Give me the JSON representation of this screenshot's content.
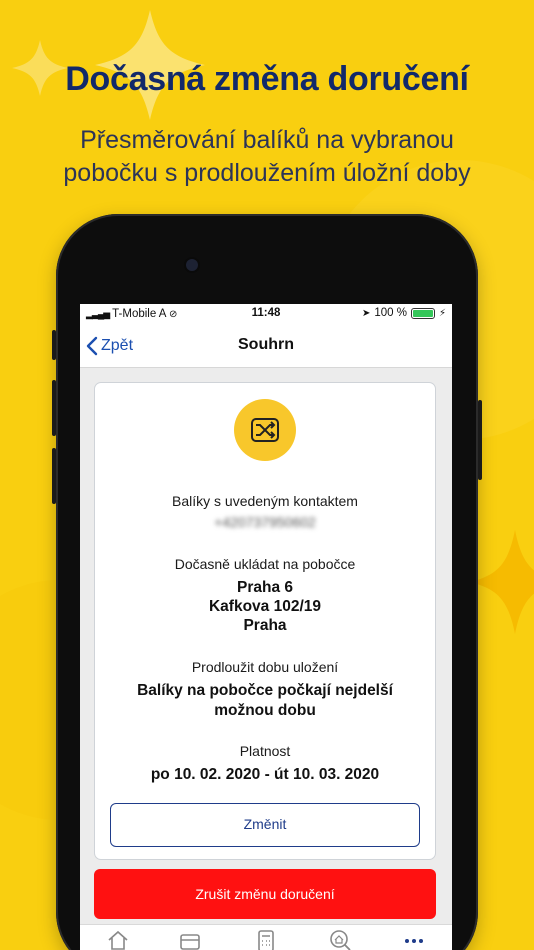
{
  "promo": {
    "title": "Dočasná změna doručení",
    "subtitle_line1": "Přesměrování balíků na vybranou",
    "subtitle_line2": "pobočku s prodloužením úložní doby"
  },
  "status_bar": {
    "carrier": "T-Mobile A",
    "time": "11:48",
    "battery": "100 %"
  },
  "nav": {
    "back_label": "Zpět",
    "title": "Souhrn"
  },
  "summary": {
    "icon": "shuffle-icon",
    "contact_label": "Balíky s uvedeným kontaktem",
    "contact_value": "+420737950602",
    "branch_label": "Dočasně ukládat na pobočce",
    "branch_line1": "Praha 6",
    "branch_line2": "Kafkova 102/19",
    "branch_line3": "Praha",
    "extend_label": "Prodloužit dobu uložení",
    "extend_value_line1": "Balíky na pobočce počkají nejdelší",
    "extend_value_line2": "možnou dobu",
    "validity_label": "Platnost",
    "validity_value": "po 10. 02. 2020 -  út 10. 03. 2020",
    "change_button": "Změnit"
  },
  "cancel_button": "Zrušit změnu doručení",
  "tabs": [
    "home-icon",
    "box-icon",
    "calculator-icon",
    "search-home-icon",
    "more-icon"
  ],
  "colors": {
    "background": "#f9cf10",
    "headline": "#12296a",
    "accent_blue": "#1f3c8a",
    "cancel_red": "#ff1111",
    "icon_yellow": "#f8c72b"
  }
}
